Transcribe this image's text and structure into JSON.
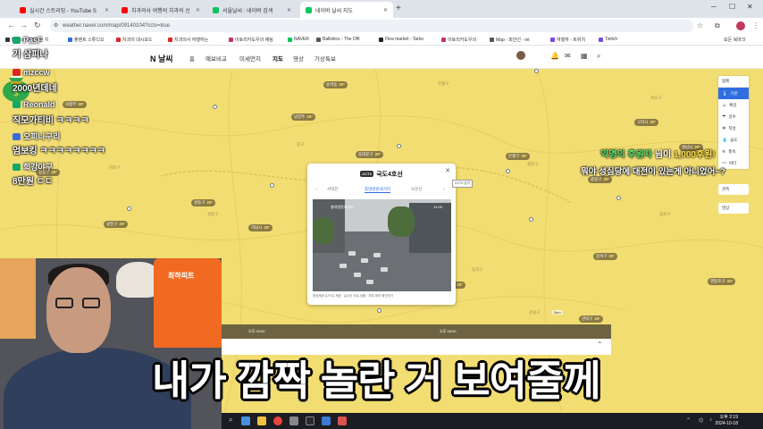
{
  "browser": {
    "tabs": [
      {
        "label": "실시간 스트리밍 - YouTube S",
        "color": "#ff0000"
      },
      {
        "label": "치과의사 여행의 치과의 신",
        "color": "#ff0000"
      },
      {
        "label": "서울날씨 : 네이버 검색",
        "color": "#03c75a"
      },
      {
        "label": "네이버 날씨 지도",
        "color": "#03c75a"
      }
    ],
    "new_tab": "+",
    "url": "weather.naver.com/map/09140104?cctv=true",
    "bookmarks": [
      {
        "label": "Dentist 여행하는 치",
        "color": "#333333"
      },
      {
        "label": "플랜트 스튜디오",
        "color": "#2f6de0"
      },
      {
        "label": "치과의 대시보드",
        "color": "#e02424"
      },
      {
        "label": "치과의사 여행하는",
        "color": "#e02424"
      },
      {
        "label": "이토리카도우의 채팅",
        "color": "#c2385c"
      },
      {
        "label": "NAVER",
        "color": "#03c75a"
      },
      {
        "label": "Ballistics - The Offi",
        "color": "#555555"
      },
      {
        "label": "Flea market - Tarko",
        "color": "#222222"
      },
      {
        "label": "이토리카도우의",
        "color": "#c2385c"
      },
      {
        "label": "Map - 피안선 - int",
        "color": "#555555"
      },
      {
        "label": "여행하 - 트위치",
        "color": "#7b4ae0"
      },
      {
        "label": "Twitch",
        "color": "#7b4ae0"
      }
    ],
    "all_bookmarks": "모든 북마크"
  },
  "naver": {
    "logo": "N 날씨",
    "menu": [
      "홈",
      "예보비교",
      "미세먼지",
      "지도",
      "영상",
      "기상특보"
    ],
    "active_menu": "지도"
  },
  "map": {
    "places": [
      "노원구",
      "마포구",
      "성동구",
      "중구",
      "강남구",
      "은평구",
      "동작구",
      "광진구",
      "서초구",
      "종로구"
    ],
    "badges": [
      {
        "name": "송석동",
        "temp": "20°"
      },
      {
        "name": "의정부",
        "temp": "20°"
      },
      {
        "name": "남양주",
        "temp": "20°"
      },
      {
        "name": "구리시",
        "temp": "20°"
      },
      {
        "name": "동대문구",
        "temp": "20°"
      },
      {
        "name": "은평구",
        "temp": "20°"
      },
      {
        "name": "중랑구",
        "temp": "20°"
      },
      {
        "name": "성동구",
        "temp": "20°"
      },
      {
        "name": "광진구",
        "temp": "20°"
      },
      {
        "name": "하남시",
        "temp": "20°"
      },
      {
        "name": "강서구",
        "temp": "20°"
      },
      {
        "name": "영등포구",
        "temp": "20°"
      },
      {
        "name": "관악구",
        "temp": "20°"
      },
      {
        "name": "강동구",
        "temp": "20°"
      },
      {
        "name": "서초구",
        "temp": "20°"
      },
      {
        "name": "성남시",
        "temp": "20°"
      }
    ],
    "legend": {
      "header": "범례",
      "items": [
        "기온",
        "체감",
        "강수",
        "적설",
        "습도",
        "풍속",
        "바다"
      ],
      "selected": "기온",
      "extra1": "관측",
      "extra2": "영상"
    },
    "scale": "5km",
    "timeline_times": [
      "오후 03:00",
      "오후 06:00"
    ]
  },
  "popup": {
    "tag": "CCTV",
    "title": "국도4호선",
    "close": "✕",
    "tooltip": "CCTV 닫기",
    "tabs": [
      "서대전",
      "충대병원네거리",
      "보문산"
    ],
    "active_tab": "충대병원네거리",
    "cam_label": "충대병원네거리",
    "cam_time": "14:26",
    "caption": "영상제공 (UTIC) 제공 · 실시간 도로 상황 · 위치 정보 확인하기"
  },
  "chat": [
    {
      "type": "user",
      "text": "PasF",
      "icon": "g"
    },
    {
      "type": "msg",
      "text": "기 삼피나"
    },
    {
      "type": "user",
      "text": "mzccw",
      "icon": "r"
    },
    {
      "type": "msg",
      "text": "2000년데네"
    },
    {
      "type": "user",
      "text": "Reonald",
      "icon": "g"
    },
    {
      "type": "msg",
      "text": "직모가티비 ㅋㅋㅋㅋ"
    },
    {
      "type": "user",
      "text": "오피나구리",
      "icon": "b"
    },
    {
      "type": "msg",
      "text": "엄보킹 ㅋㅋㅋㅋㅋㅋㅋㅋ"
    },
    {
      "type": "user",
      "text": "희강야구",
      "icon": "g"
    },
    {
      "type": "msg",
      "text": "8만원 ㄷㄷ"
    }
  ],
  "donation": {
    "name": "익명의 후원자",
    "suffix": " 님이 ",
    "amount": "1,000후원!",
    "message": "뭐야 성심당에 대전이 있는게 아니었어~?"
  },
  "webcam": {
    "jersey_text": "최하피트"
  },
  "subtitle": "내가 깜짝 놀란 거 보여줄께",
  "taskbar": {
    "search": "⌕",
    "time": "오후 2:19",
    "date": "2024-10-18"
  },
  "colors": {
    "map_yellow": "#f2dd72",
    "accent_blue": "#2f6de0",
    "naver_green": "#03c75a"
  }
}
